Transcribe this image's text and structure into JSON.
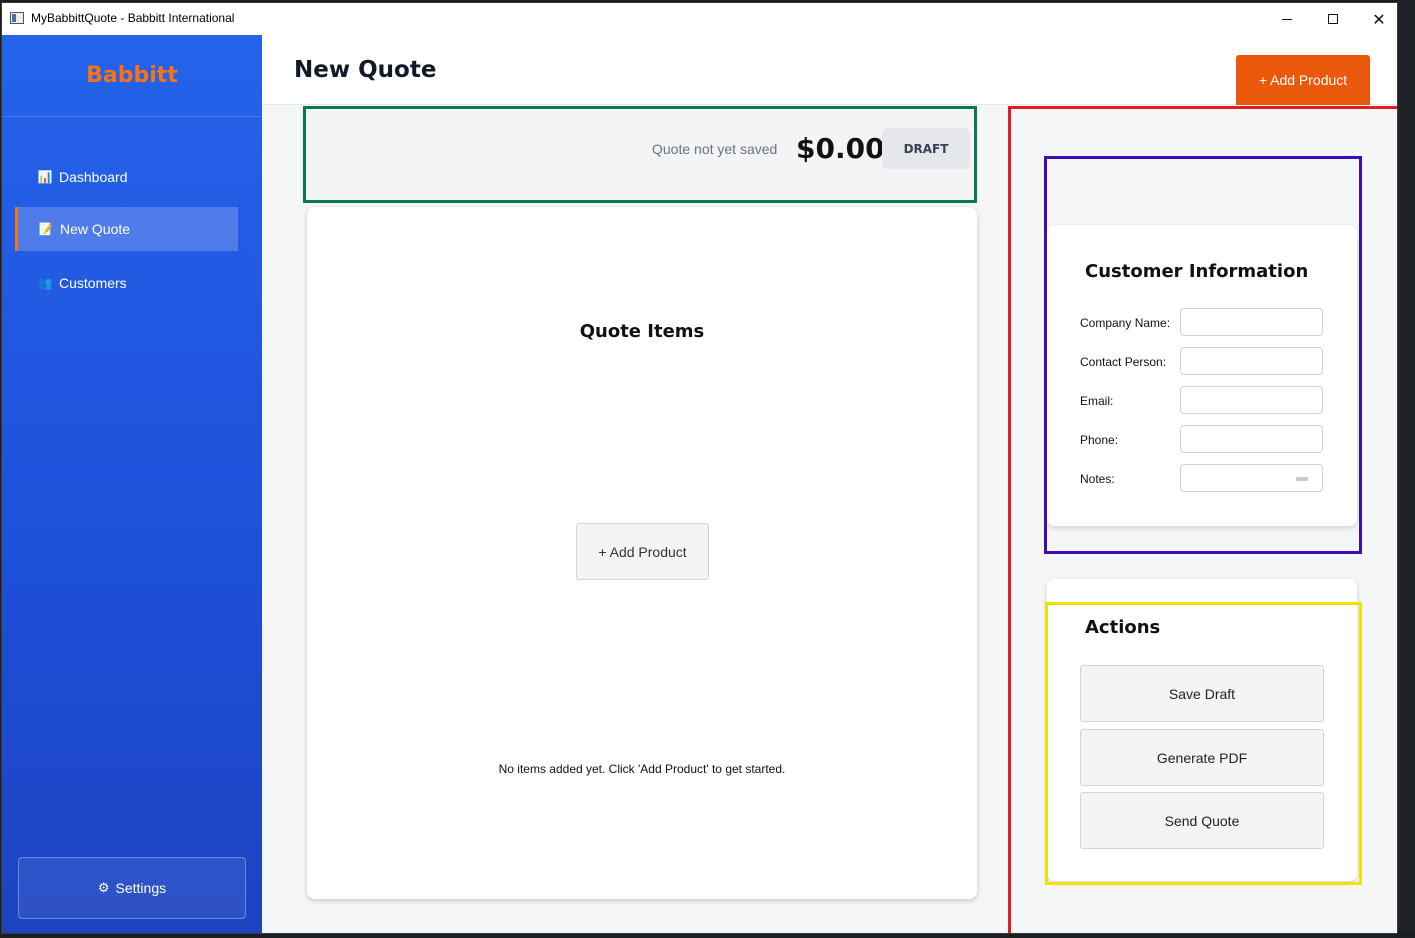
{
  "window": {
    "title": "MyBabbittQuote - Babbitt International",
    "controls": {
      "minimize": "minimize-icon",
      "maximize": "maximize-icon",
      "close": "✕"
    }
  },
  "sidebar": {
    "brand": "Babbitt",
    "items": [
      {
        "label": "Dashboard",
        "icon": "📊"
      },
      {
        "label": "New Quote",
        "icon": "📝",
        "active": true
      },
      {
        "label": "Customers",
        "icon": "👥"
      }
    ],
    "settings": {
      "label": "Settings",
      "icon": "⚙"
    }
  },
  "header": {
    "title": "New Quote",
    "add_product": "+ Add Product"
  },
  "status": {
    "save_state": "Quote not yet saved",
    "total": "$0.00",
    "badge": "DRAFT"
  },
  "quote_items": {
    "title": "Quote Items",
    "add_product": "+ Add Product",
    "empty_message": "No items added yet. Click 'Add Product' to get started."
  },
  "customer": {
    "title": "Customer Information",
    "fields": [
      {
        "label": "Company Name:",
        "value": ""
      },
      {
        "label": "Contact Person:",
        "value": ""
      },
      {
        "label": "Email:",
        "value": ""
      },
      {
        "label": "Phone:",
        "value": ""
      },
      {
        "label": "Notes:",
        "value": ""
      }
    ]
  },
  "actions": {
    "title": "Actions",
    "buttons": [
      "Save Draft",
      "Generate PDF",
      "Send Quote"
    ]
  },
  "colors": {
    "sidebar": "#2563eb",
    "brand": "#f97316",
    "accent_button": "#ea580c",
    "annotation_green": "#0a7a4a",
    "annotation_red": "#e11d24",
    "annotation_purple": "#3b0fb5",
    "annotation_yellow": "#f5e100"
  }
}
